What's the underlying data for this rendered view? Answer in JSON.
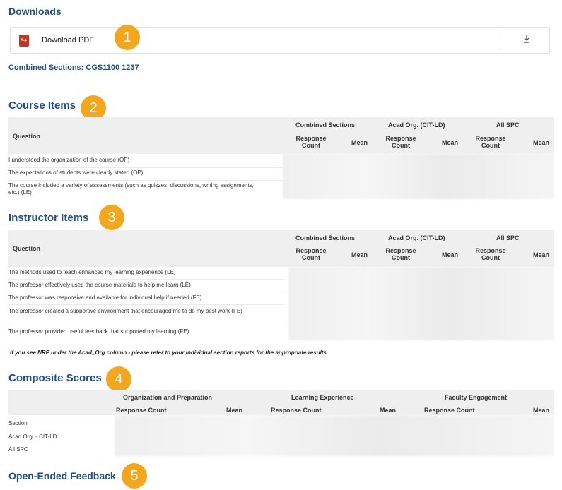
{
  "downloads": {
    "heading": "Downloads",
    "pdf_label": "Download PDF",
    "pdf_icon": "pdf-icon",
    "download_icon": "download-icon"
  },
  "combined_sections_link": "Combined Sections: CGS1100 1237",
  "badges": [
    "1",
    "2",
    "3",
    "4",
    "5"
  ],
  "accent_color": "#f4a71d",
  "heading_color": "#1f4e8c",
  "course_items": {
    "heading": "Course Items",
    "question_header": "Question",
    "groups": [
      "Combined Sections",
      "Acad Org. (CIT-LD)",
      "All SPC"
    ],
    "response_count": "Response Count",
    "mean": "Mean",
    "rows": [
      "I understood the organization of the course (OP)",
      "The expectations of students were clearly stated (OP)",
      "The course included a variety of assessments (such as quizzes, discussions, writing assignments, etc.) (LE)"
    ]
  },
  "instructor_items": {
    "heading": "Instructor Items",
    "question_header": "Question",
    "groups": [
      "Combined Sections",
      "Acad Org. (CIT-LD)",
      "All SPC"
    ],
    "response_count": "Response Count",
    "mean": "Mean",
    "rows": [
      "The methods used to teach enhanced my learning experience (LE)",
      "The professor effectively used the course materials to help me learn (LE)",
      "The professor was responsive and available for individual help if needed (FE)",
      "The professor created a supportive environment that encouraged me to do my best work (FE)",
      "The professor provided useful feedback that supported my learning (FE)"
    ]
  },
  "nrp_note": "If you see NRP under the Acad_Org column - please refer to your individual section reports for the appropriate results",
  "composite_scores": {
    "heading": "Composite Scores",
    "groups": [
      "Organization and Preparation",
      "Learning Experience",
      "Faculty Engagement"
    ],
    "response_count": "Response Count",
    "mean": "Mean",
    "rows": [
      "Section",
      "Acad Org. - CIT-LD",
      "All SPC"
    ]
  },
  "open_ended": {
    "heading": "Open-Ended Feedback"
  }
}
